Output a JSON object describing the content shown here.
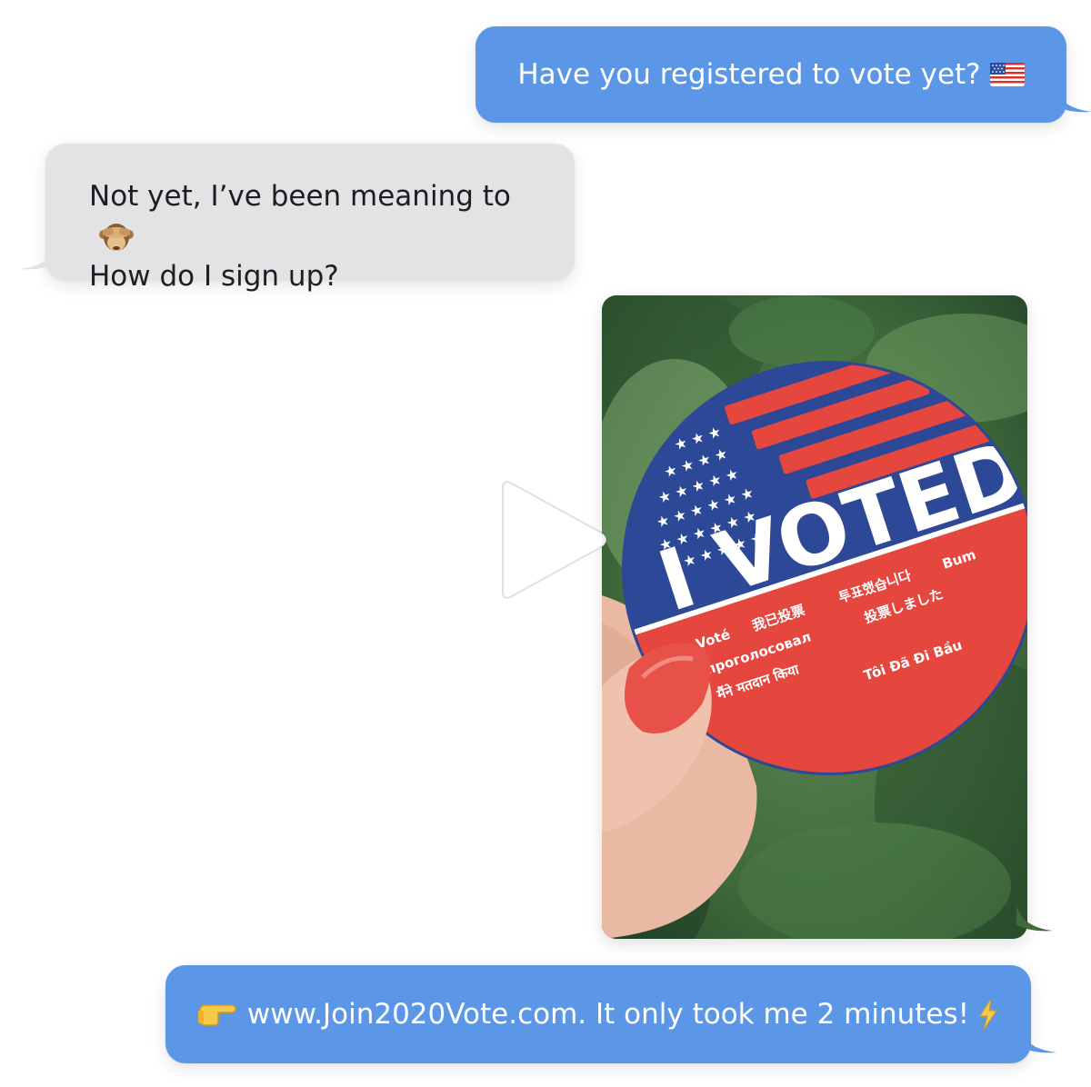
{
  "messages": [
    {
      "side": "sent",
      "text": "Have you registered to vote yet?",
      "emoji": "us-flag-icon"
    },
    {
      "side": "received",
      "lines": [
        "Not yet, I’ve been meaning to",
        "How do I sign up?"
      ],
      "emoji": "see-no-evil-monkey-icon"
    },
    {
      "side": "sent",
      "type": "video",
      "content": "I VOTED sticker held in hand"
    },
    {
      "side": "sent",
      "text": "www.Join2020Vote.com. It only took me 2 minutes!",
      "leading_emoji": "pointing-hand-icon",
      "trailing_emoji": "lightning-icon"
    }
  ],
  "sticker": {
    "headline": "I VOTED",
    "translations": [
      "Yo Voté",
      "我已投票",
      "투표했습니다",
      "Bum",
      "Я проголосовал",
      "投票しました",
      "मैंने मतदान किया",
      "Tôi Đã Đi Bầu"
    ]
  },
  "colors": {
    "sent_bubble": "#5b97e6",
    "received_bubble": "#e3e3e6",
    "sticker_blue": "#2e4fa0",
    "sticker_red": "#e5463d"
  }
}
